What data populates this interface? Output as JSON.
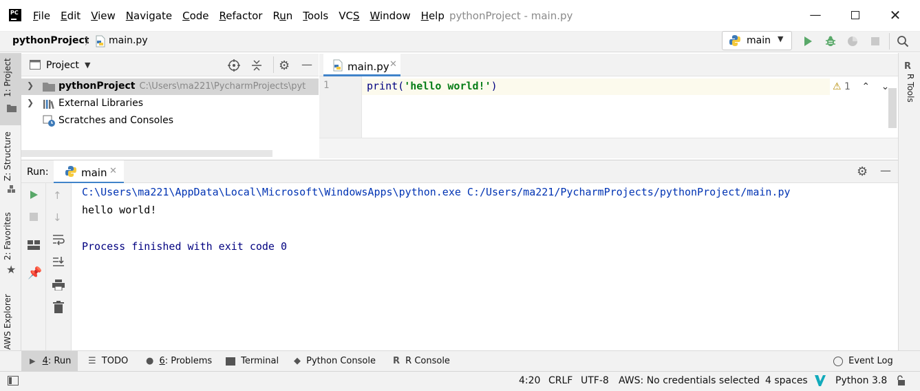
{
  "titlebar": {
    "menu": [
      {
        "pre": "",
        "u": "F",
        "post": "ile"
      },
      {
        "pre": "",
        "u": "E",
        "post": "dit"
      },
      {
        "pre": "",
        "u": "V",
        "post": "iew"
      },
      {
        "pre": "",
        "u": "N",
        "post": "avigate"
      },
      {
        "pre": "",
        "u": "C",
        "post": "ode"
      },
      {
        "pre": "",
        "u": "R",
        "post": "efactor"
      },
      {
        "pre": "R",
        "u": "u",
        "post": "n"
      },
      {
        "pre": "",
        "u": "T",
        "post": "ools"
      },
      {
        "pre": "VC",
        "u": "S",
        "post": ""
      },
      {
        "pre": "",
        "u": "W",
        "post": "indow"
      },
      {
        "pre": "",
        "u": "H",
        "post": "elp"
      }
    ],
    "window_title": "pythonProject - main.py",
    "app_icon_text": "PC"
  },
  "navbar": {
    "project": "pythonProject",
    "file": "main.py",
    "run_config": "main"
  },
  "left_strip": {
    "project_tab": "1: Project",
    "structure_tab": "Z: Structure",
    "favorites_tab": "2: Favorites",
    "aws_tab": "AWS Explorer"
  },
  "right_strip": {
    "r_tools": "R Tools"
  },
  "project_panel": {
    "title": "Project",
    "tree": [
      {
        "label": "pythonProject",
        "path": "C:\\Users\\ma221\\PycharmProjects\\pyt"
      },
      {
        "label": "External Libraries",
        "path": ""
      },
      {
        "label": "Scratches and Consoles",
        "path": ""
      }
    ]
  },
  "editor": {
    "tab_label": "main.py",
    "line_number": "1",
    "code_prefix": "print(",
    "code_string": "'hello world!'",
    "code_suffix": ")",
    "warning_count": "1"
  },
  "run_panel": {
    "label": "Run:",
    "tab_label": "main",
    "console": [
      "C:\\Users\\ma221\\AppData\\Local\\Microsoft\\WindowsApps\\python.exe C:/Users/ma221/PycharmProjects/pythonProject/main.py",
      "hello world!",
      "Process finished with exit code 0"
    ]
  },
  "bottom_tabs": {
    "run": {
      "num": "4",
      "rest": ": Run"
    },
    "todo": "TODO",
    "problems": {
      "num": "6",
      "rest": ": Problems"
    },
    "terminal": "Terminal",
    "python_console": "Python Console",
    "r_console": "R Console",
    "event_log": "Event Log"
  },
  "statusbar": {
    "position": "4:20",
    "line_sep": "CRLF",
    "encoding": "UTF-8",
    "aws": "AWS: No credentials selected",
    "indent": "4 spaces",
    "interpreter": "Python 3.8"
  },
  "colors": {
    "accent": "#4083c9",
    "run_green": "#59a869",
    "console_blue": "#0033b3",
    "string_green": "#067d17"
  }
}
